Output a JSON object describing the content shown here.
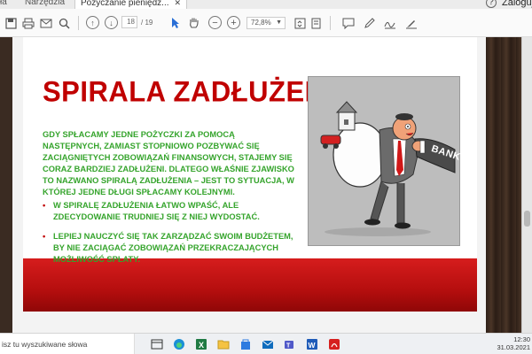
{
  "tabs": [
    {
      "label": "ła",
      "active": false
    },
    {
      "label": "Narzędzia",
      "active": false
    },
    {
      "label": "Pożyczanie pieniędz...",
      "active": true
    }
  ],
  "header": {
    "help": "?",
    "login": "Zaloguj"
  },
  "toolbar": {
    "icons": [
      "save-icon",
      "print-icon",
      "email-icon",
      "search-icon",
      "page-up-icon",
      "page-down-icon",
      "cursor-icon",
      "hand-icon",
      "zoom-out-icon",
      "zoom-in-icon",
      "comment-icon",
      "pen-icon",
      "signature-icon",
      "sign-icon"
    ],
    "page_current": "18",
    "page_total": "/ 19",
    "zoom": "72,8%"
  },
  "slide": {
    "title": "SPIRALA ZADŁUŻENIA",
    "paragraph": "GDY SPŁACAMY JEDNE POŻYCZKI ZA POMOCĄ NASTĘPNYCH, ZAMIAST STOPNIOWO POZBYWAĆ SIĘ ZACIĄGNIĘTYCH ZOBOWIĄZAŃ FINANSOWYCH, STAJEMY SIĘ CORAZ BARDZIEJ ZADŁUŻENI. DLATEGO WŁAŚNIE ZJAWISKO TO NAZWANO SPIRALĄ ZADŁUŻENIA – JEST TO SYTUACJA, W KTÓREJ JEDNE DŁUGI SPŁACAMY KOLEJNYMI.",
    "bullets": [
      "W SPIRALĘ ZADŁUŻENIA ŁATWO WPAŚĆ, ALE ZDECYDOWANIE TRUDNIEJ SIĘ Z NIEJ WYDOSTAĆ.",
      " LEPIEJ NAUCZYĆ SIĘ TAK ZARZĄDZAĆ SWOIM BUDŻETEM, BY NIE ZACIĄGAĆ  ZOBOWIĄZAŃ PRZEKRACZAJĄCYCH MOŻLIWOŚĆ SPŁATY."
    ],
    "cartoon_label": "BANK",
    "colors": {
      "title": "#c00000",
      "text": "#35a42c",
      "band": "#c41414"
    }
  },
  "taskbar": {
    "search_placeholder": "isz tu wyszukiwane słowa",
    "apps": [
      "task-view-icon",
      "edge-icon",
      "excel-icon",
      "file-explorer-icon",
      "store-icon",
      "mail-icon",
      "teams-icon",
      "word-icon",
      "acrobat-icon"
    ],
    "time": "12:30",
    "date": "31.03.2021"
  }
}
